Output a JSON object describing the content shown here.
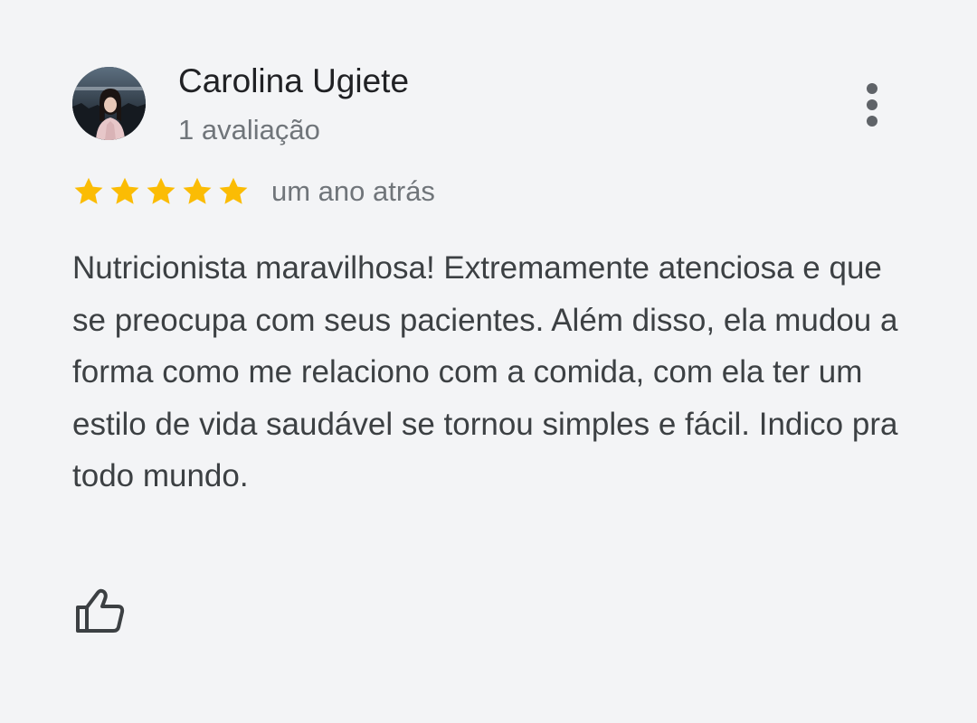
{
  "review": {
    "author_name": "Carolina Ugiete",
    "author_meta": "1 avaliação",
    "rating": 5,
    "rating_max": 5,
    "date": "um ano atrás",
    "text": "Nutricionista maravilhosa! Extremamente atenciosa e que se preocupa com seus pacientes. Além disso, ela mudou a forma como me relaciono com a comida, com ela ter um estilo de vida saudável se tornou simples e fácil. Indico pra todo mundo.",
    "icons": {
      "avatar": "profile-photo",
      "more": "more-vert-icon",
      "star": "star-icon",
      "like": "thumb-up-icon"
    }
  },
  "colors": {
    "background": "#f3f4f6",
    "star": "#fbbc04",
    "name": "#202124",
    "meta": "#70757a",
    "body": "#3c4043",
    "icon": "#5f6368"
  }
}
